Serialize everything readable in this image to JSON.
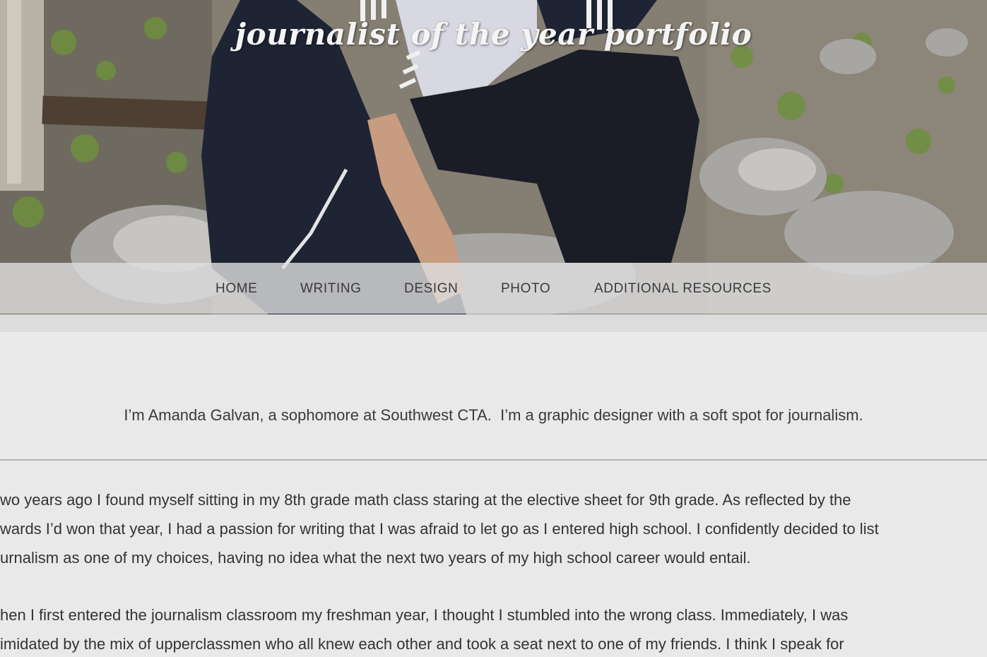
{
  "site": {
    "title": "journalist of the year portfolio"
  },
  "nav": {
    "items": [
      {
        "label": "HOME"
      },
      {
        "label": "WRITING"
      },
      {
        "label": "DESIGN"
      },
      {
        "label": "PHOTO"
      },
      {
        "label": "ADDITIONAL RESOURCES"
      }
    ]
  },
  "content": {
    "intro": "I’m Amanda Galvan, a sophomore at Southwest CTA.  I’m a graphic designer with a soft spot for journalism.",
    "paragraphs": [
      {
        "lines": [
          "wo years ago I found myself sitting in my 8th grade math class staring at the elective sheet for 9th grade. As reflected by the",
          "wards I’d won that year, I had a passion for writing that I was afraid to let go as I entered high school. I confidently decided to list",
          "urnalism as one of my choices, having no idea what the next two years of my high school career would entail."
        ]
      },
      {
        "lines": [
          "hen I first entered the journalism classroom my freshman year, I thought I stumbled into the wrong class. Immediately, I was",
          "imidated by the mix of upperclassmen who all knew each other and took a seat next to one of my friends. I think I speak for"
        ]
      }
    ]
  }
}
